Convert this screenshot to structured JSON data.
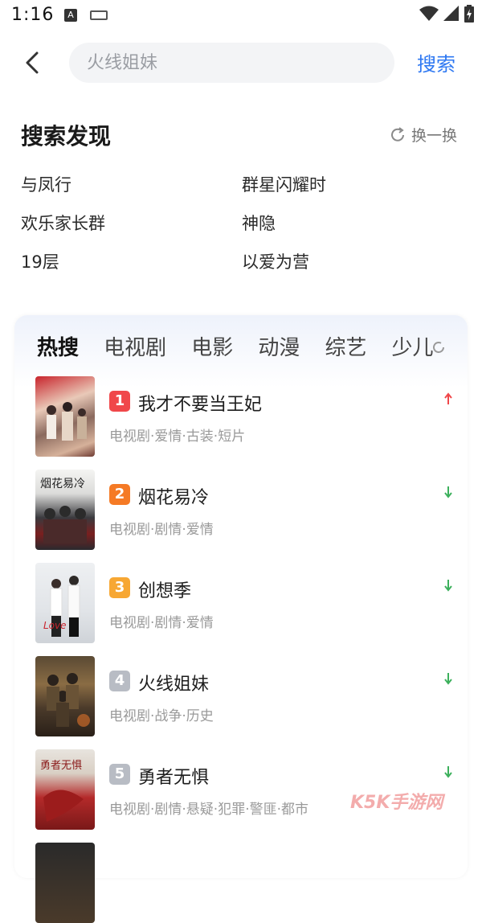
{
  "status_bar": {
    "time": "1:16",
    "badge": "A"
  },
  "search": {
    "placeholder": "火线姐妹",
    "submit_label": "搜索"
  },
  "discovery": {
    "title": "搜索发现",
    "refresh_label": "换一换",
    "items": [
      "与凤行",
      "群星闪耀时",
      "欢乐家长群",
      "神隐",
      "19层",
      "以爱为营"
    ]
  },
  "hot": {
    "tabs": [
      "热搜",
      "电视剧",
      "电影",
      "动漫",
      "综艺",
      "少儿"
    ],
    "items": [
      {
        "rank": "1",
        "title": "我才不要当王妃",
        "tags": "电视剧·爱情·古装·短片",
        "trend": "up"
      },
      {
        "rank": "2",
        "title": "烟花易冷",
        "tags": "电视剧·剧情·爱情",
        "trend": "down"
      },
      {
        "rank": "3",
        "title": "创想季",
        "tags": "电视剧·剧情·爱情",
        "trend": "down"
      },
      {
        "rank": "4",
        "title": "火线姐妹",
        "tags": "电视剧·战争·历史",
        "trend": "down"
      },
      {
        "rank": "5",
        "title": "勇者无惧",
        "tags": "电视剧·剧情·悬疑·犯罪·警匪·都市",
        "trend": "down"
      }
    ]
  },
  "colors": {
    "accent": "#2e78f2",
    "rank1": "#f0474a",
    "rank2": "#f57a25",
    "rank3": "#f7a733",
    "rank_other": "#b8bcc4",
    "trend_up": "#f0474a",
    "trend_down": "#3cb05c"
  },
  "watermark": "K5K手游网"
}
